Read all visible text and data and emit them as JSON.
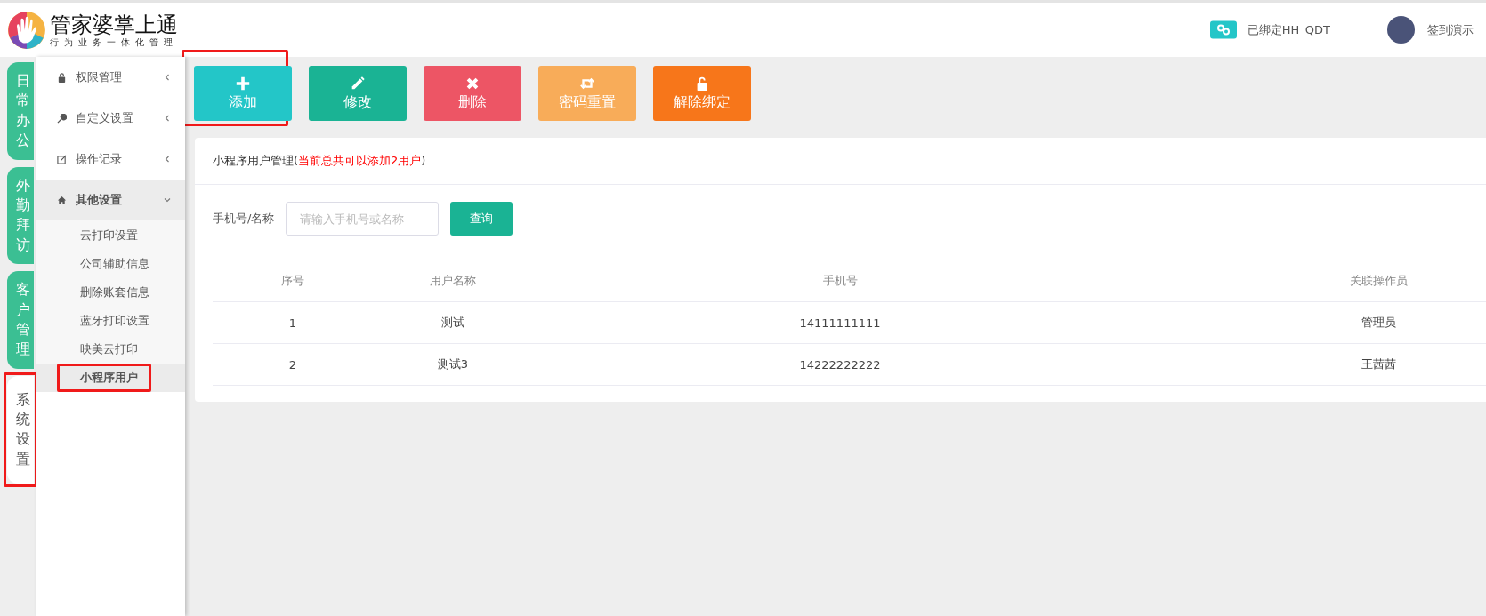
{
  "header": {
    "logo_title": "管家婆掌上通",
    "logo_subtitle": "行为业务一体化管理",
    "binding": "已绑定HH_QDT",
    "user": "签到演示"
  },
  "rail": [
    {
      "label": "日常办公",
      "selected": false,
      "highlighted": false
    },
    {
      "label": "外勤拜访",
      "selected": false,
      "highlighted": false
    },
    {
      "label": "客户管理",
      "selected": false,
      "highlighted": false
    },
    {
      "label": "系统设置",
      "selected": true,
      "highlighted": true
    }
  ],
  "menu": [
    {
      "label": "权限管理",
      "expanded": false
    },
    {
      "label": "自定义设置",
      "expanded": false
    },
    {
      "label": "操作记录",
      "expanded": false
    },
    {
      "label": "其他设置",
      "expanded": true,
      "children": [
        {
          "label": "云打印设置",
          "selected": false,
          "highlighted": false
        },
        {
          "label": "公司辅助信息",
          "selected": false,
          "highlighted": false
        },
        {
          "label": "删除账套信息",
          "selected": false,
          "highlighted": false
        },
        {
          "label": "蓝牙打印设置",
          "selected": false,
          "highlighted": false
        },
        {
          "label": "映美云打印",
          "selected": false,
          "highlighted": false
        },
        {
          "label": "小程序用户",
          "selected": true,
          "highlighted": true
        }
      ]
    }
  ],
  "toolbar": [
    {
      "label": "添加",
      "color": "#23c6c8",
      "highlighted": true
    },
    {
      "label": "修改",
      "color": "#1ab394",
      "highlighted": false
    },
    {
      "label": "删除",
      "color": "#ed5565",
      "highlighted": false
    },
    {
      "label": "密码重置",
      "color": "#f8ac59",
      "highlighted": false
    },
    {
      "label": "解除绑定",
      "color": "#f7761a",
      "highlighted": false
    }
  ],
  "card": {
    "title": "小程序用户管理(",
    "note": "当前总共可以添加2用户",
    "title_close": ")"
  },
  "search": {
    "label": "手机号/名称",
    "placeholder": "请输入手机号或名称",
    "button": "查询"
  },
  "table": {
    "columns": [
      "序号",
      "用户名称",
      "手机号",
      "关联操作员"
    ],
    "rows": [
      [
        "1",
        "测试",
        "14111111111",
        "管理员"
      ],
      [
        "2",
        "测试3",
        "14222222222",
        "王茜茜"
      ]
    ]
  }
}
